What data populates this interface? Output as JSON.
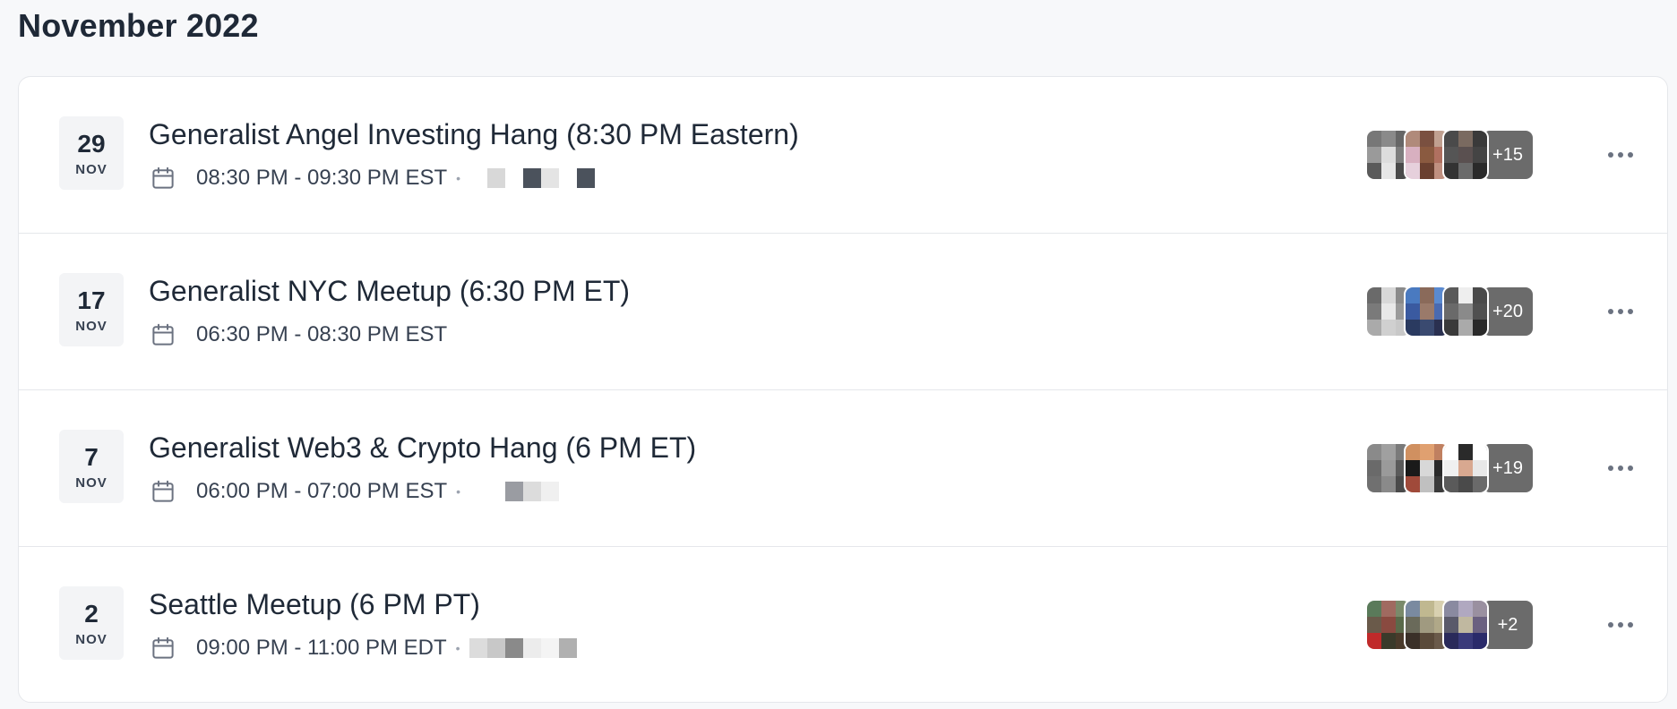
{
  "page": {
    "month_title": "November 2022"
  },
  "events": [
    {
      "day": "29",
      "month": "NOV",
      "title": "Generalist Angel Investing Hang (8:30 PM Eastern)",
      "time": "08:30 PM - 09:30 PM EST",
      "separator": "•",
      "more_count": "+15",
      "avatar_colors": [
        [
          "#777777",
          "#8a8a8a",
          "#666666",
          "#9a9a9a",
          "#dddddd",
          "#7d7d7d",
          "#5a5a5a",
          "#e6e6e6",
          "#4a4a4a"
        ],
        [
          "#b08a7a",
          "#7a5040",
          "#c0a090",
          "#d8b0c0",
          "#8a5a40",
          "#b07060",
          "#e6d0dc",
          "#6a4030",
          "#c09080"
        ],
        [
          "#4a4a4a",
          "#7a6a60",
          "#3a3a3a",
          "#555555",
          "#5a5050",
          "#444444",
          "#333333",
          "#6a6a6a",
          "#2a2a2a"
        ]
      ],
      "location_blocks": [
        "#ffffff",
        "#d8d8d8",
        "#ffffff",
        "#4b525c",
        "#e4e4e4",
        "#ffffff",
        "#4b525c"
      ]
    },
    {
      "day": "17",
      "month": "NOV",
      "title": "Generalist NYC Meetup (6:30 PM ET)",
      "time": "06:30 PM - 08:30 PM EST",
      "separator": "",
      "more_count": "+20",
      "avatar_colors": [
        [
          "#6a6a6a",
          "#d8d8d8",
          "#8a8a8a",
          "#7a7a7a",
          "#e8e8e8",
          "#9a9a9a",
          "#aaaaaa",
          "#d0d0d0",
          "#c8c8c8"
        ],
        [
          "#4a7ac0",
          "#8a6a5a",
          "#5a8ad0",
          "#3a5aa0",
          "#9a7a6a",
          "#4a6ab0",
          "#2a3a60",
          "#3a4a70",
          "#2a3050"
        ],
        [
          "#5a5a5a",
          "#eeeeee",
          "#4a4a4a",
          "#6a6a6a",
          "#8a8a8a",
          "#505050",
          "#3a3a3a",
          "#aaaaaa",
          "#2a2a2a"
        ]
      ],
      "location_blocks": []
    },
    {
      "day": "7",
      "month": "NOV",
      "title": "Generalist Web3 & Crypto Hang (6 PM ET)",
      "time": "06:00 PM - 07:00 PM EST",
      "separator": "•",
      "more_count": "+19",
      "avatar_colors": [
        [
          "#8a8a8a",
          "#a0a0a0",
          "#7a7a7a",
          "#6a6a6a",
          "#9a9a9a",
          "#5a5a5a",
          "#707070",
          "#8a8a8a",
          "#4a4a4a"
        ],
        [
          "#d09060",
          "#e0a070",
          "#c08060",
          "#1a1a1a",
          "#d8d8d8",
          "#2a2a2a",
          "#a04a3a",
          "#c0c0c0",
          "#3a3a3a"
        ],
        [
          "#ffffff",
          "#2a2a2a",
          "#ffffff",
          "#f0f0f0",
          "#d8a890",
          "#e8e8e8",
          "#5a5a5a",
          "#4a4a4a",
          "#6a6a6a"
        ]
      ],
      "location_blocks": [
        "#ffffff",
        "#ffffff",
        "#9a9ca2",
        "#dcdcdc",
        "#f0f0f0"
      ]
    },
    {
      "day": "2",
      "month": "NOV",
      "title": "Seattle Meetup (6 PM PT)",
      "time": "09:00 PM - 11:00 PM EDT",
      "separator": "•",
      "more_count": "+2",
      "avatar_colors": [
        [
          "#5a7a5a",
          "#a06a60",
          "#7a8a6a",
          "#6a5a4a",
          "#8a4a40",
          "#5a6a4a",
          "#c02a2a",
          "#3a3a2a",
          "#4a3a2a"
        ],
        [
          "#7a8aa0",
          "#c0b890",
          "#d8d0b0",
          "#6a6a5a",
          "#a09a80",
          "#b0a888",
          "#3a3028",
          "#5a4a3a",
          "#6a5a4a"
        ],
        [
          "#8a8aa0",
          "#b0a8c0",
          "#9a90a0",
          "#5a5a6a",
          "#c0b8a0",
          "#6a6080",
          "#2a2a5a",
          "#3a3a7a",
          "#2a2a6a"
        ]
      ],
      "location_blocks": [
        "#dcdcdc",
        "#c8c8c8",
        "#8a8a8a",
        "#ececec",
        "#f4f4f4",
        "#b0b0b0"
      ]
    }
  ]
}
